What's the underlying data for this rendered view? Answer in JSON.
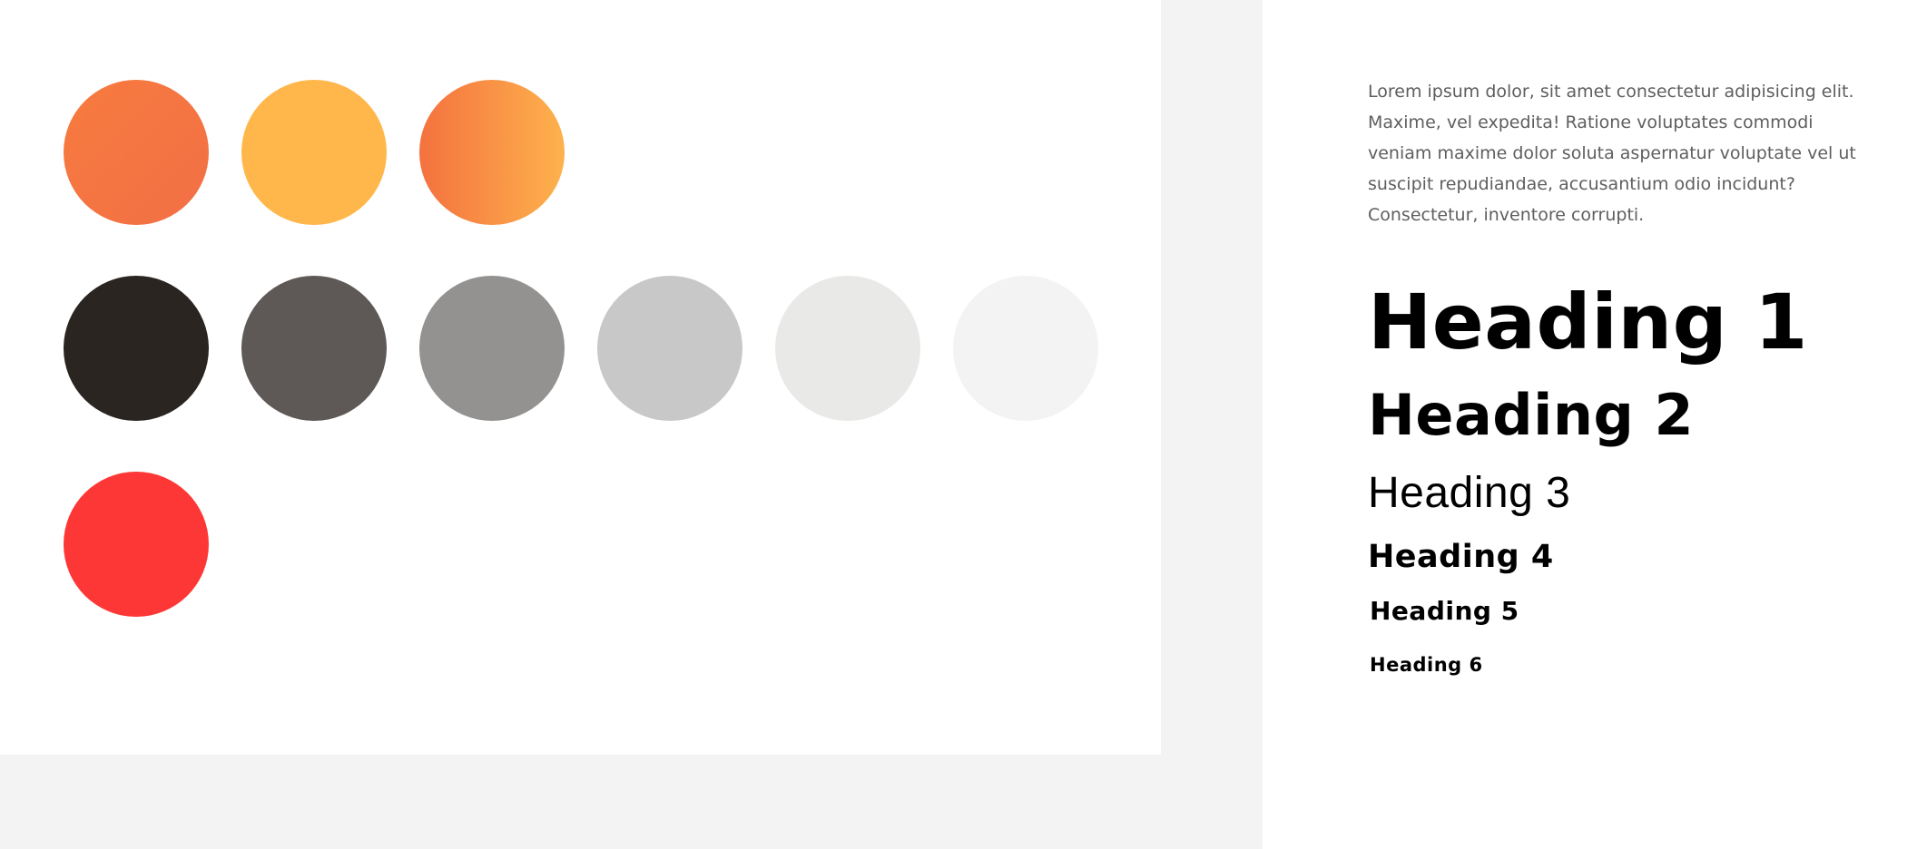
{
  "palette": {
    "swatches": [
      {
        "name": "orange-gradient",
        "fill": "linear-gradient(135deg, #f77b3f, #f26f45)"
      },
      {
        "name": "amber",
        "fill": "#ffb74b"
      },
      {
        "name": "orange-amber-gradient",
        "fill": "linear-gradient(90deg, #f4723f 0%, #fdb24c 100%)"
      },
      {
        "name": "black",
        "fill": "#2b2522"
      },
      {
        "name": "dark-gray",
        "fill": "#5e5957"
      },
      {
        "name": "mid-gray",
        "fill": "#939291"
      },
      {
        "name": "light-gray",
        "fill": "#c8c8c8"
      },
      {
        "name": "pale-gray",
        "fill": "#e9e9e8"
      },
      {
        "name": "off-white",
        "fill": "#f3f3f3"
      },
      {
        "name": "red",
        "fill": "#fd3735"
      }
    ]
  },
  "typography": {
    "body": "Lorem ipsum dolor, sit amet consectetur adipisicing elit. Maxime, vel expedita! Ratione voluptates commodi veniam maxime dolor soluta aspernatur voluptate vel ut suscipit repudiandae, accusantium odio incidunt? Consectetur, inventore corrupti.",
    "headings": {
      "h1": "Heading 1",
      "h2": "Heading 2",
      "h3": "Heading 3",
      "h4": "Heading 4",
      "h5": "Heading 5",
      "h6": "Heading 6"
    }
  }
}
